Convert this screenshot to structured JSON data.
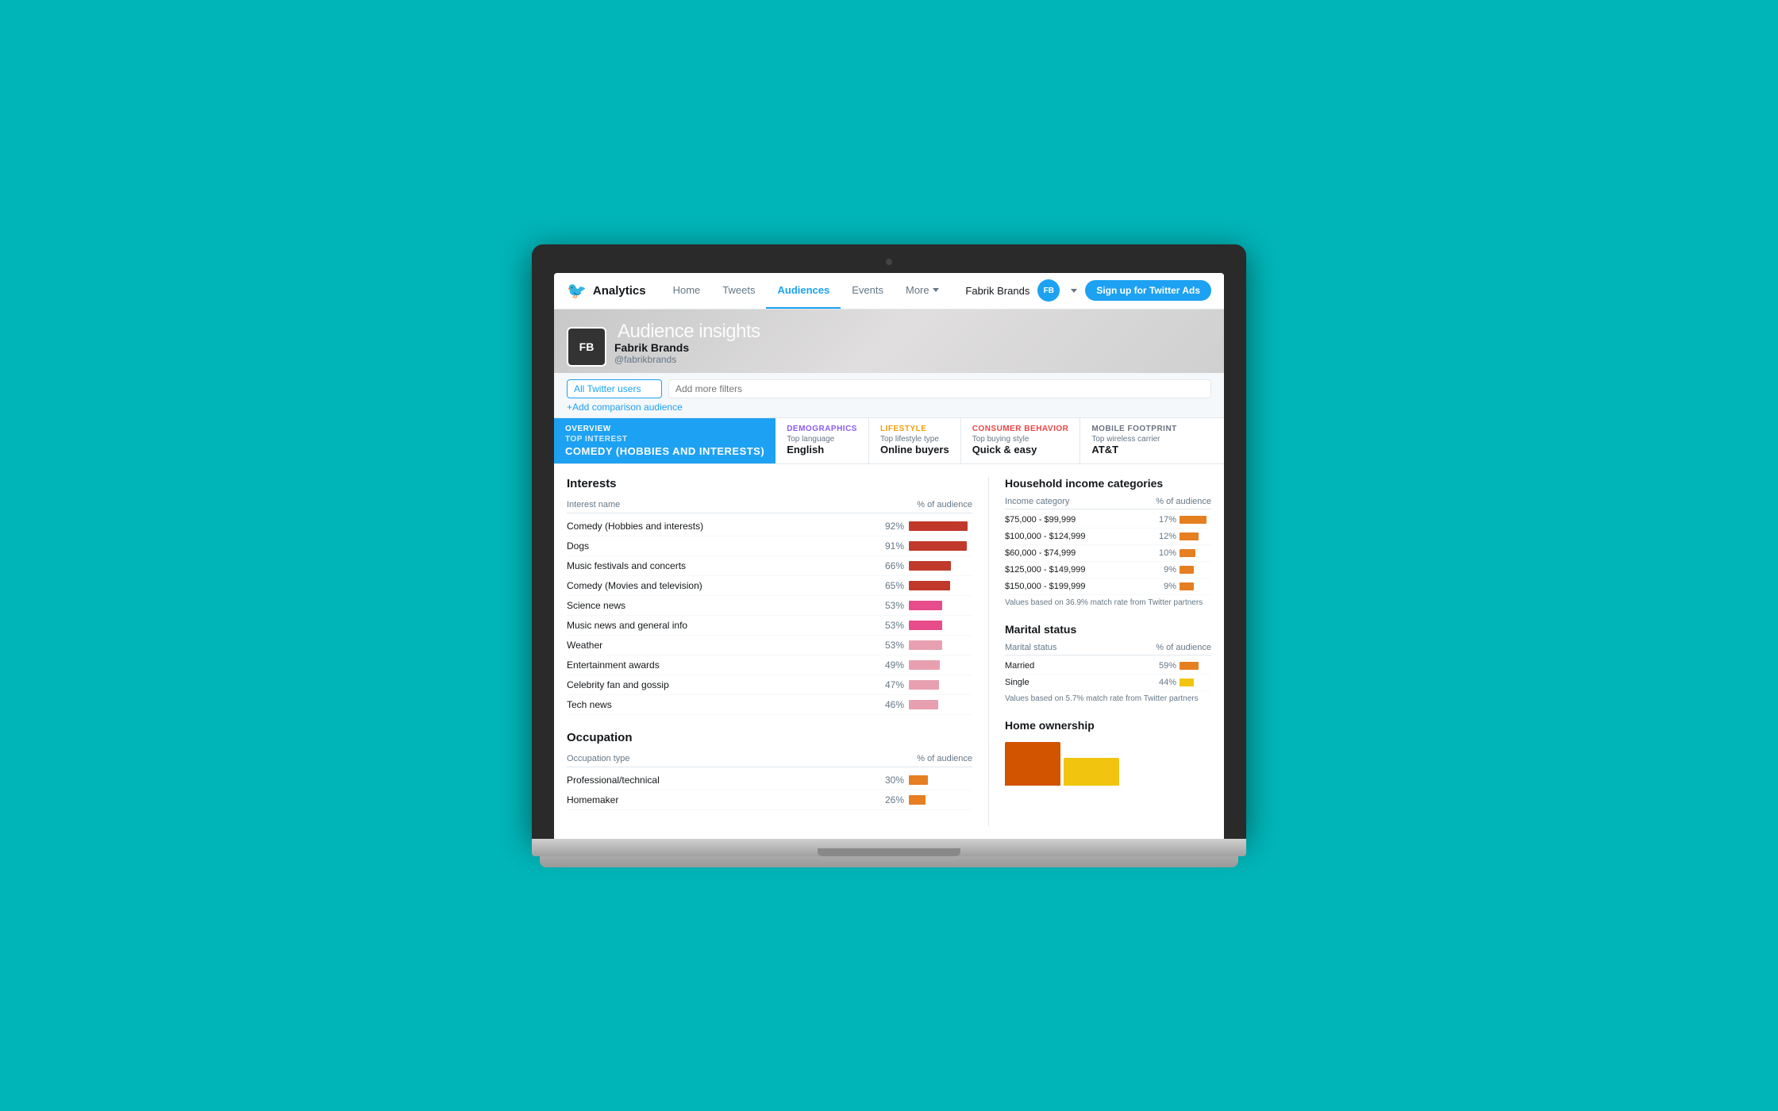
{
  "laptop": {
    "background_color": "#00b5b8"
  },
  "nav": {
    "logo_symbol": "🐦",
    "analytics_label": "Analytics",
    "links": [
      {
        "id": "home",
        "label": "Home",
        "active": false
      },
      {
        "id": "tweets",
        "label": "Tweets",
        "active": false
      },
      {
        "id": "audiences",
        "label": "Audiences",
        "active": true
      },
      {
        "id": "events",
        "label": "Events",
        "active": false
      },
      {
        "id": "more",
        "label": "More",
        "active": false,
        "has_chevron": true
      }
    ],
    "account_name": "Fabrik Brands",
    "signup_button_label": "Sign up for Twitter Ads"
  },
  "hero": {
    "title": "Audience insights",
    "profile_name": "Fabrik Brands",
    "profile_handle": "@fabrikbrands",
    "profile_initials": "FB"
  },
  "filter": {
    "selected_audience": "All Twitter users",
    "filter_placeholder": "Add more filters",
    "add_comparison_label": "+Add comparison audience"
  },
  "tabs": {
    "overview": {
      "label": "OVERVIEW",
      "sublabel": "Top interest",
      "value": "Comedy (Hobbies and interests)"
    },
    "demographics": {
      "label": "DEMOGRAPHICS",
      "sublabel": "Top language",
      "value": "English"
    },
    "lifestyle": {
      "label": "LIFESTYLE",
      "sublabel": "Top lifestyle type",
      "value": "Online buyers"
    },
    "consumer_behavior": {
      "label": "CONSUMER BEHAVIOR",
      "sublabel": "Top buying style",
      "value": "Quick & easy"
    },
    "mobile_footprint": {
      "label": "MOBILE FOOTPRINT",
      "sublabel": "Top wireless carrier",
      "value": "AT&T"
    }
  },
  "interests": {
    "section_title": "Interests",
    "col_interest": "Interest name",
    "col_audience": "% of audience",
    "items": [
      {
        "name": "Comedy (Hobbies and interests)",
        "pct": 92,
        "pct_label": "92%",
        "color": "#c0392b"
      },
      {
        "name": "Dogs",
        "pct": 91,
        "pct_label": "91%",
        "color": "#c0392b"
      },
      {
        "name": "Music festivals and concerts",
        "pct": 66,
        "pct_label": "66%",
        "color": "#c0392b"
      },
      {
        "name": "Comedy (Movies and television)",
        "pct": 65,
        "pct_label": "65%",
        "color": "#c0392b"
      },
      {
        "name": "Science news",
        "pct": 53,
        "pct_label": "53%",
        "color": "#e74c8b"
      },
      {
        "name": "Music news and general info",
        "pct": 53,
        "pct_label": "53%",
        "color": "#e74c8b"
      },
      {
        "name": "Weather",
        "pct": 53,
        "pct_label": "53%",
        "color": "#e8a0b0"
      },
      {
        "name": "Entertainment awards",
        "pct": 49,
        "pct_label": "49%",
        "color": "#e8a0b0"
      },
      {
        "name": "Celebrity fan and gossip",
        "pct": 47,
        "pct_label": "47%",
        "color": "#e8a0b0"
      },
      {
        "name": "Tech news",
        "pct": 46,
        "pct_label": "46%",
        "color": "#e8a0b0"
      }
    ]
  },
  "occupation": {
    "section_title": "Occupation",
    "col_type": "Occupation type",
    "col_audience": "% of audience",
    "items": [
      {
        "name": "Professional/technical",
        "pct": 30,
        "pct_label": "30%",
        "color": "#e67e22"
      },
      {
        "name": "Homemaker",
        "pct": 26,
        "pct_label": "26%",
        "color": "#e67e22"
      }
    ]
  },
  "household_income": {
    "section_title": "Household income categories",
    "col_category": "Income category",
    "col_audience": "% of audience",
    "items": [
      {
        "name": "$75,000 - $99,999",
        "pct": 17,
        "pct_label": "17%",
        "color": "#e67e22"
      },
      {
        "name": "$100,000 - $124,999",
        "pct": 12,
        "pct_label": "12%",
        "color": "#e67e22"
      },
      {
        "name": "$60,000 - $74,999",
        "pct": 10,
        "pct_label": "10%",
        "color": "#e67e22"
      },
      {
        "name": "$125,000 - $149,999",
        "pct": 9,
        "pct_label": "9%",
        "color": "#e67e22"
      },
      {
        "name": "$150,000 - $199,999",
        "pct": 9,
        "pct_label": "9%",
        "color": "#e67e22"
      }
    ],
    "note": "Values based on 36.9% match rate from Twitter partners"
  },
  "marital_status": {
    "section_title": "Marital status",
    "col_status": "Marital status",
    "col_audience": "% of audience",
    "items": [
      {
        "name": "Married",
        "pct": 59,
        "pct_label": "59%",
        "color": "#e67e22"
      },
      {
        "name": "Single",
        "pct": 44,
        "pct_label": "44%",
        "color": "#f1c40f"
      }
    ],
    "note": "Values based on 5.7% match rate from Twitter partners"
  },
  "home_ownership": {
    "section_title": "Home ownership",
    "bars": [
      {
        "color": "#d35400",
        "height": 55
      },
      {
        "color": "#f1c40f",
        "height": 35
      }
    ]
  }
}
